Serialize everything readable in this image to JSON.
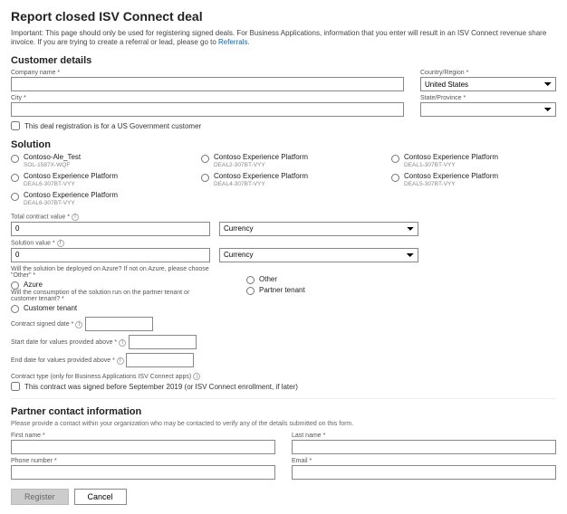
{
  "page": {
    "title": "Report closed ISV Connect deal",
    "important_prefix": "Important:",
    "important_text": "This page should only be used for registering signed deals. For Business Applications, information that you enter will result in an ISV Connect revenue share invoice. If you are trying to create a referral or lead, please go to ",
    "important_link": "Referrals"
  },
  "customer": {
    "section": "Customer details",
    "company_label": "Company name *",
    "country_label": "Country/Region *",
    "country_value": "United States",
    "city_label": "City *",
    "state_label": "State/Province *",
    "gov_label": "This deal registration is for a US Government customer"
  },
  "solution": {
    "section": "Solution",
    "items": [
      [
        {
          "name": "Contoso-Ale_Test",
          "sku": "SOL-1587X-WQF"
        },
        {
          "name": "Contoso Experience Platform",
          "sku": "DEAL6-307BT-VYY"
        },
        {
          "name": "Contoso Experience Platform",
          "sku": "DEAL6-307BT-VYY"
        }
      ],
      [
        {
          "name": "Contoso Experience Platform",
          "sku": "DEAL2-307BT-VYY"
        },
        {
          "name": "Contoso Experience Platform",
          "sku": "DEAL4-307BT-VYY"
        }
      ],
      [
        {
          "name": "Contoso Experience Platform",
          "sku": "DEAL1-307BT-VYY"
        },
        {
          "name": "Contoso Experience Platform",
          "sku": "DEAL5-307BT-VYY"
        }
      ]
    ],
    "total_label": "Total contract value *",
    "total_value": "0",
    "solution_value_label": "Solution value *",
    "solution_value": "0",
    "currency_label": "Currency",
    "deploy_label": "Will the solution be deployed on Azure? If not on Azure, please choose \"Other\" *",
    "deploy_azure": "Azure",
    "deploy_other": "Other",
    "consumption_label": "Will the consumption of the solution run on the partner tenant or customer tenant? *",
    "consumption_customer": "Customer tenant",
    "consumption_partner": "Partner tenant",
    "signed_label": "Contract signed date *",
    "start_label": "Start date for values provided above *",
    "end_label": "End date for values provided above *",
    "contract_type_label": "Contract type (only for Business Applications ISV Connect apps)",
    "contract_type_checkbox": "This contract was signed before September 2019 (or ISV Connect enrollment, if later)"
  },
  "partner": {
    "section": "Partner contact information",
    "note": "Please provide a contact within your organization who may be contacted to verify any of the details submitted on this form.",
    "first_label": "First name *",
    "last_label": "Last name *",
    "phone_label": "Phone number *",
    "email_label": "Email *"
  },
  "buttons": {
    "register": "Register",
    "cancel": "Cancel"
  }
}
